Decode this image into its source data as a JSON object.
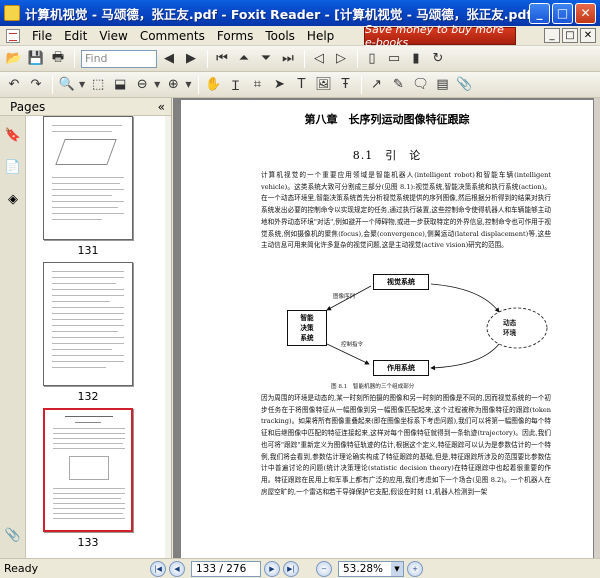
{
  "window": {
    "title": "计算机视觉 - 马颂德，张正友.pdf - Foxit Reader - [计算机视觉 - 马颂德，张正友.pdf]",
    "minimize": "_",
    "maximize": "□",
    "close": "✕"
  },
  "menu": {
    "items": [
      "File",
      "Edit",
      "View",
      "Comments",
      "Forms",
      "Tools",
      "Help"
    ],
    "ad": "Save money to buy more e-books",
    "mdi": [
      "_",
      "□",
      "✕"
    ]
  },
  "toolbar": {
    "find_placeholder": "Find"
  },
  "sidebar": {
    "title": "Pages",
    "collapse": "«",
    "thumbnails": [
      {
        "number": "131"
      },
      {
        "number": "132"
      },
      {
        "number": "133",
        "selected": true
      }
    ]
  },
  "document": {
    "chapter_title": "第八章　长序列运动图像特征跟踪",
    "section_title": "8.1　引　论",
    "paragraph1": "计算机视觉的一个重要应用领域是智能机器人(intelligent robot)和智能车辆(intelligent vehicle)。这类系统大致可分割成三部分(见图 8.1):视觉系统,智能决策系统和执行系统(action)。在一个动态环境里,智能决策系统首先分析视觉系统提供的序列图像,然后根据分析得到的结果对执行系统发出必要的控制命令以实现规定的任务,通过执行装置,这些控制命令使得机器人和车辆能够主动地和外界动态环境\"对话\",例如避开一个障碍物,或进一步获取特定的外界信息,控制命令也可作用于视觉系统,例如摄像机的聚焦(focus),会聚(convergence),侧翼运动(lateral displacement)等,这些主动信息可用来简化许多复杂的视觉问题,这是主动视觉(active vision)研究的范围。",
    "figure": {
      "vision": "视觉系统",
      "decision_line1": "智能",
      "decision_line2": "决策",
      "decision_line3": "系统",
      "action": "作用系统",
      "env_line1": "动态",
      "env_line2": "环境",
      "label_image_seq": "图像序列",
      "label_control": "控制指令",
      "caption": "图 8.1　智能机器的三个组成部分"
    },
    "paragraph2": "因为周围的环境是动态的,某一时刻所拍摄的图像和另一时刻的图像是不同的,因而视觉系统的一个初步任务在于将图像特征从一幅图像到另一幅图像匹配起来,这个过程被称为图像特征的跟踪(token tracking)。如果将所有图像重叠起来(即在图像坐标系下考虑问题),我们可以将第一幅图像的每个特征和后继图像中匹配的特征连接起来,这样对每个图像特征就得到一条轨迹(trajectory)。因此,我们也可将\"跟踪\"重新定义为图像特征轨迹的估计,根据这个定义,特征跟踪可以认为是参数估计的一个特例,我们将会看到,参数估计理论确实构成了特征跟踪的基础,但是,特征跟踪所涉及的范围要比参数估计中普遍讨论的问题(统计决策理论(statistic decision theory)在特征跟踪中也起着很重要的作用。特征跟踪在民用上和军事上都有广泛的应用,我们考虑如下一个场合(见图 8.2)。一个机器人在房屋空旷的,一个雷达和若干导弹保护它支配,假设在时刻 t1,机器人检测到一架"
  },
  "status": {
    "ready": "Ready",
    "page": "133 / 276",
    "zoom": "53.28%"
  }
}
